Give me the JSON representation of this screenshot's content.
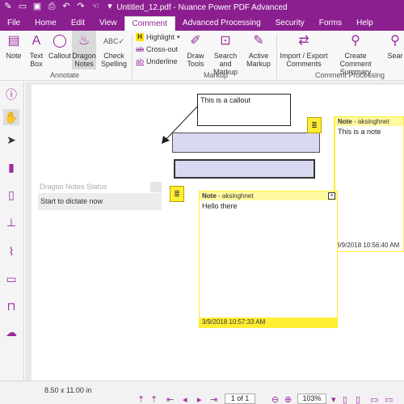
{
  "window": {
    "title": "Untitled_12.pdf - Nuance Power PDF Advanced"
  },
  "tabs": [
    "File",
    "Home",
    "Edit",
    "View",
    "Comment",
    "Advanced Processing",
    "Security",
    "Forms",
    "Help"
  ],
  "ribbon": {
    "note": "Note",
    "textbox": "Text\nBox",
    "textbox_a": "Text",
    "textbox_b": "Box",
    "callout": "Callout",
    "dragon_a": "Dragon",
    "dragon_b": "Notes",
    "check_a": "Check",
    "check_b": "Spelling",
    "highlight": "Highlight",
    "crossout": "Cross-out",
    "underline": "Underline",
    "draw_a": "Draw",
    "draw_b": "Tools",
    "search_a": "Search and",
    "search_b": "Markup",
    "active_a": "Active",
    "active_b": "Markup",
    "import_a": "Import / Export",
    "import_b": "Comments",
    "create_a": "Create Comment",
    "create_b": "Summary",
    "sear_a": "Sear",
    "groups": {
      "annotate": "Annotate",
      "markup": "Markup",
      "comment_processing": "Comment Processing"
    }
  },
  "document": {
    "callout_text": "This is a callout",
    "dragon_panel_title": "Dragon Notes Status",
    "dragon_panel_body": "Start to dictate now",
    "note1": {
      "label": "Note",
      "author": "- aksinghnet",
      "body": "This is a note",
      "date": "3/9/2018 10:56:40 AM"
    },
    "note2": {
      "label": "Note",
      "author": "- aksinghnet",
      "body": "Hello there",
      "date": "3/9/2018 10:57:33 AM"
    }
  },
  "status": {
    "page_size": "8.50 x 11.00 in",
    "page": "1 of 1",
    "zoom": "103%"
  },
  "colors": {
    "brand": "#8b1f8f",
    "note_yellow": "#ffee33",
    "shape_fill": "#d9d9f2"
  }
}
